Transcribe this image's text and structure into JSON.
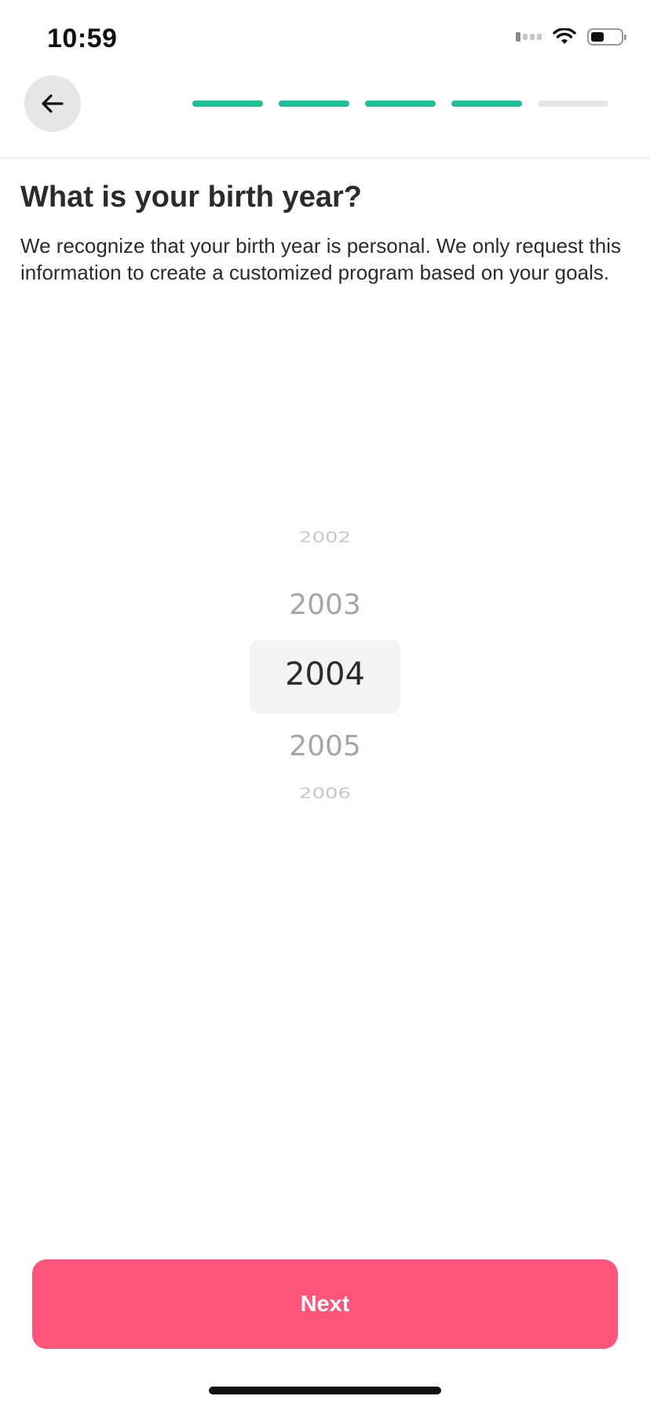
{
  "status_bar": {
    "time": "10:59",
    "icons": [
      "signal-icon",
      "wifi-icon",
      "battery-icon"
    ]
  },
  "header": {
    "back_icon": "arrow-left-icon",
    "progress": {
      "total_steps": 5,
      "completed_steps": 4,
      "active_color": "#1dbf98",
      "inactive_color": "#e6e6e6"
    }
  },
  "main": {
    "title": "What is your birth year?",
    "description": "We recognize that your birth year is personal. We only request this information to create a customized program based on your goals."
  },
  "picker": {
    "items": [
      {
        "label": "2002",
        "state": "far"
      },
      {
        "label": "2003",
        "state": "near"
      },
      {
        "label": "2004",
        "state": "selected"
      },
      {
        "label": "2005",
        "state": "near"
      },
      {
        "label": "2006",
        "state": "far"
      }
    ],
    "selected_value": "2004"
  },
  "footer": {
    "next_label": "Next",
    "button_color": "#ff557a"
  }
}
